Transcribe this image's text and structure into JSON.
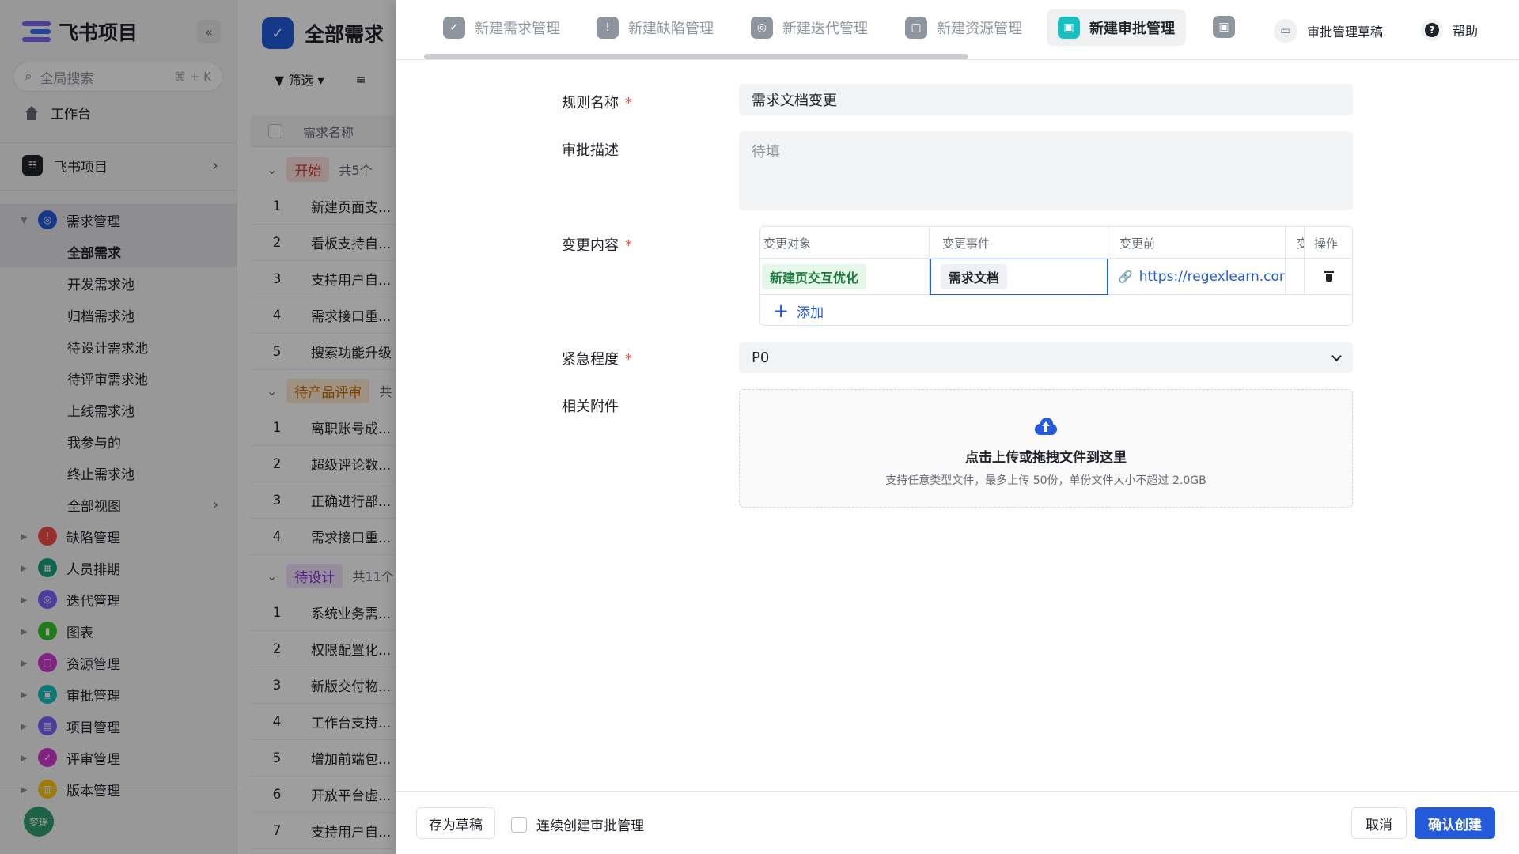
{
  "sidebar": {
    "brand": "飞书项目",
    "collapse_icon": "«",
    "search_placeholder": "全局搜索",
    "search_shortcut": "⌘ + K",
    "workbench": "工作台",
    "space_name": "飞书项目",
    "space_icon_text": "☷",
    "tree": [
      {
        "label": "需求管理",
        "color": "#245bdb",
        "icon": "◎",
        "expanded": true
      },
      {
        "label": "全部需求",
        "sub": true,
        "active": true
      },
      {
        "label": "开发需求池",
        "sub": true
      },
      {
        "label": "归档需求池",
        "sub": true
      },
      {
        "label": "待设计需求池",
        "sub": true
      },
      {
        "label": "待评审需求池",
        "sub": true
      },
      {
        "label": "上线需求池",
        "sub": true
      },
      {
        "label": "我参与的",
        "sub": true
      },
      {
        "label": "终止需求池",
        "sub": true
      },
      {
        "label": "全部视图",
        "sub": true,
        "chev": true
      },
      {
        "label": "缺陷管理",
        "color": "#f54a45",
        "icon": "!"
      },
      {
        "label": "人员排期",
        "color": "#14a37f",
        "icon": "▦"
      },
      {
        "label": "迭代管理",
        "color": "#7b61ff",
        "icon": "◎"
      },
      {
        "label": "图表",
        "color": "#34c724",
        "icon": "▮"
      },
      {
        "label": "资源管理",
        "color": "#d136d1",
        "icon": "▢"
      },
      {
        "label": "审批管理",
        "color": "#14c0c0",
        "icon": "▣"
      },
      {
        "label": "项目管理",
        "color": "#7b61ff",
        "icon": "▤"
      },
      {
        "label": "评审管理",
        "color": "#d136d1",
        "icon": "✓"
      },
      {
        "label": "版本管理",
        "color": "#ffc60a",
        "icon": "▥"
      }
    ],
    "avatar": "梦瑶"
  },
  "main": {
    "title": "全部需求",
    "title_icon": "✓",
    "toolbar": {
      "filter": "筛选",
      "sort_icon": "≡"
    },
    "column_name": "需求名称",
    "groups": [
      {
        "tag": "开始",
        "count": "共5个",
        "bg": "#fde2e2",
        "fg": "#d83931",
        "rows": [
          "新建页面支...",
          "看板支持自...",
          "支持用户自...",
          "需求接口重...",
          "搜索功能升级"
        ]
      },
      {
        "tag": "待产品评审",
        "count": "共",
        "bg": "#feead2",
        "fg": "#c76a00",
        "rows": [
          "离职账号成...",
          "超级评论数...",
          "正确进行部...",
          "需求接口重..."
        ]
      },
      {
        "tag": "待设计",
        "count": "共11个",
        "bg": "#f0e2fc",
        "fg": "#8f2ad6",
        "rows": [
          "系统业务需...",
          "权限配置化...",
          "新版交付物...",
          "工作台支持...",
          "增加前端包...",
          "开放平台虚...",
          "支持用户自..."
        ]
      }
    ]
  },
  "drawer": {
    "tabs": [
      {
        "label": "新建需求管理",
        "icon": "✓"
      },
      {
        "label": "新建缺陷管理",
        "icon": "!"
      },
      {
        "label": "新建迭代管理",
        "icon": "◎"
      },
      {
        "label": "新建资源管理",
        "icon": "▢"
      },
      {
        "label": "新建审批管理",
        "icon": "▣",
        "active": true
      }
    ],
    "more_icon": "▣",
    "draft_link": "审批管理草稿",
    "help": "帮助",
    "help_icon": "?",
    "form": {
      "rule_name_label": "规则名称",
      "rule_name_value": "需求文档变更",
      "desc_label": "审批描述",
      "desc_placeholder": "待填",
      "change_label": "变更内容",
      "change_columns": [
        "变更对象",
        "变更事件",
        "变更前",
        "变",
        "操作"
      ],
      "change_row": {
        "object": "新建页交互优化",
        "event": "需求文档",
        "before": "https://regexlearn.com/",
        "after": "",
        "link_icon": "🔗"
      },
      "add_label": "添加",
      "add_icon": "+",
      "urgency_label": "紧急程度",
      "urgency_value": "P0",
      "attach_label": "相关附件",
      "upload_title": "点击上传或拖拽文件到这里",
      "upload_sub": "支持任意类型文件，最多上传 50份，单份文件大小不超过 2.0GB"
    },
    "footer": {
      "save_draft": "存为草稿",
      "continuous": "连续创建审批管理",
      "cancel": "取消",
      "confirm": "确认创建"
    }
  },
  "colors": {
    "accent": "#245bdb",
    "required": "#f54a45",
    "active_tab_icon": "#14c0c0"
  }
}
